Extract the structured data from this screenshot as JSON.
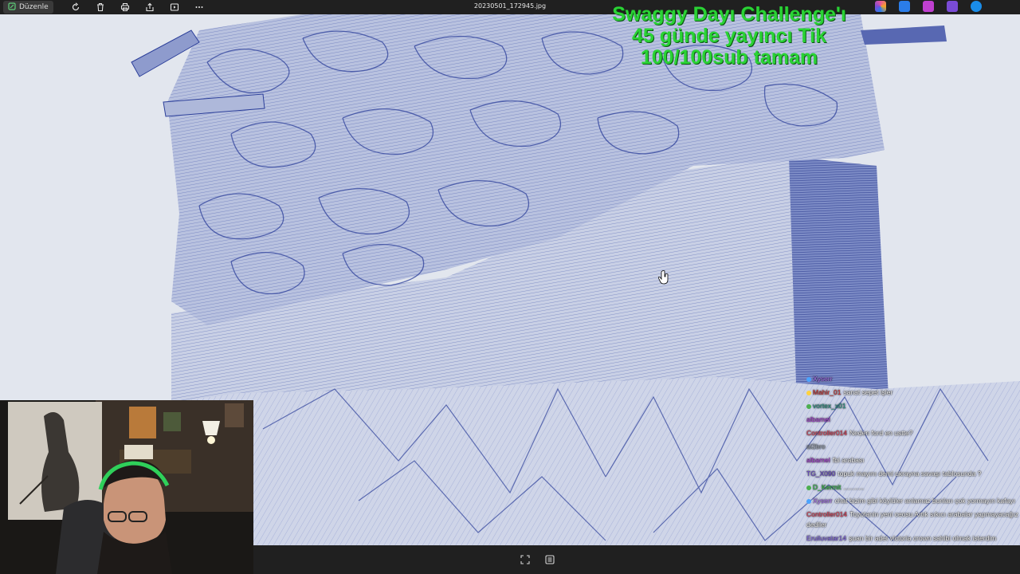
{
  "toolbar": {
    "edit_label": "Düzenle",
    "file_name": "20230501_172945.jpg",
    "icons": [
      "rotate-icon",
      "delete-icon",
      "print-icon",
      "share-icon",
      "slideshow-icon",
      "more-icon"
    ],
    "tray_apps": [
      {
        "name": "copilot-icon",
        "color": "#e8559a"
      },
      {
        "name": "draw-app-icon",
        "color": "#2b7de9"
      },
      {
        "name": "clipchamp-icon",
        "color": "#c040d0"
      },
      {
        "name": "teams-icon",
        "color": "#7a4bd6"
      },
      {
        "name": "onedrive-icon",
        "color": "#1a8de9"
      }
    ]
  },
  "overlay": {
    "challenge_lines": [
      "Swaggy Dayı Challenge'ı",
      "45 günde yayıncı Tik",
      "100/100sub tamam"
    ],
    "colors": {
      "text": "#2ad335",
      "shadow": "#0b5a10"
    }
  },
  "chat": {
    "messages": [
      {
        "user": "Xyserr",
        "color": "#b57cff",
        "text": "",
        "emote": true
      },
      {
        "user": "Mahir_01",
        "color": "#d63a3a",
        "text": "sanat sepet işler"
      },
      {
        "user": "vortex_x01",
        "color": "#2d9c8a",
        "text": "",
        "emote": true
      },
      {
        "user": "albamel",
        "color": "#b23fe0",
        "text": ""
      },
      {
        "user": "Controller014",
        "color": "#e3425a",
        "text": "Neden ford en ustte?"
      },
      {
        "user": "al2bro",
        "color": "#9aa3b0",
        "text": "",
        "emote": true
      },
      {
        "user": "albamel",
        "color": "#b23fe0",
        "text": "fbi arabası"
      },
      {
        "user": "TG_X090",
        "color": "#6f4fd0",
        "text": "topuk mayını demi ukrayna savaşı tablosunda ?"
      },
      {
        "user": "D_Kermit",
        "color": "#33c24a",
        "text": "..........."
      },
      {
        "user": "Xyserr",
        "color": "#b57cff",
        "text": "chat bizim gibi köylüler anlamaz bunları çok yormayın kafayı"
      },
      {
        "user": "Controller014",
        "color": "#e3425a",
        "text": "Toyotanin yeni ceosu Artık sıkıcı arabalar yapmayacağız dediler"
      },
      {
        "user": "Eruiluvatar14",
        "color": "#8a6cf0",
        "text": "şuan bir adet victoria crown sahibi olmak isterdim"
      }
    ]
  },
  "colors": {
    "ink": "#2c3f9a",
    "paper": "#e2e6ee",
    "toolbar_bg": "#202020"
  }
}
